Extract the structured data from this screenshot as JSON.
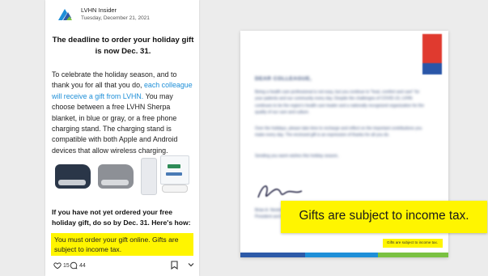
{
  "post": {
    "author": "LVHN Insider",
    "date": "Tuesday, December 21, 2021",
    "headline": "The deadline to order your holiday gift is now Dec. 31.",
    "body_prefix": "To celebrate the holiday season, and to thank you for all that you do, ",
    "body_link": "each colleague will receive a gift from LVHN.",
    "body_suffix": " You may choose between a free LVHN Sherpa blanket, in blue or gray, or a free phone charging stand. The charging stand is compatible with both Apple and Android devices that allow wireless charging.",
    "cta": "If you have not yet ordered your free holiday gift, do so by Dec. 31. Here's how:",
    "highlight": "You must order your gift online. Gifts are subject to income tax.",
    "likes": "15",
    "comments": "44",
    "icons": [
      "lvhn-logo",
      "heart-icon",
      "comment-icon",
      "bookmark-icon",
      "chevron-down-icon"
    ]
  },
  "letter": {
    "salutation": "DEAR COLLEAGUE,",
    "paragraph_1": "Being a health care professional is not easy, but you continue to \"heal, comfort and care\" for your patients and our community every day. Despite the challenges of COVID-19, LVHN continues to be the region's health care leader and a nationally recognized organization for the quality of our care and culture.",
    "paragraph_2": "Over the holidays, please take time to recharge and reflect on the important contributions you make every day. The enclosed gift is an expression of thanks for all you do.",
    "paragraph_3": "Sending you warm wishes this holiday season,",
    "signer": "Brian A. Nester, DO, MBA, FACOEP",
    "signer_title": "President and Chief Executive Officer",
    "small_highlight": "Gifts are subject to income tax.",
    "colors": {
      "badge_red": "#e03a2f",
      "badge_blue": "#2a56a8",
      "bar_blue": "#2d5aa8",
      "bar_light": "#1e8fd8",
      "bar_green": "#7ac142"
    }
  },
  "callout": {
    "text": "Gifts are subject to income tax.",
    "color": "#fff500"
  }
}
